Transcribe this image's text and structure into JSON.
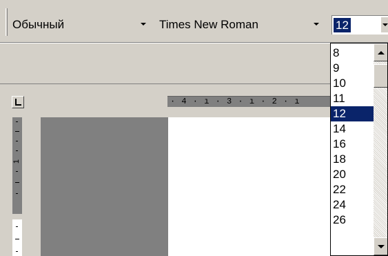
{
  "toolbar": {
    "style_combo": {
      "value": "Обычный"
    },
    "font_combo": {
      "value": "Times New Roman"
    },
    "size_combo": {
      "value": "12"
    }
  },
  "ruler": {
    "horizontal_text": "· 4 · ı · 3 · ı · 2 · ı",
    "vertical_number": "1"
  },
  "size_dropdown": {
    "items": [
      "8",
      "9",
      "10",
      "11",
      "12",
      "14",
      "16",
      "18",
      "20",
      "22",
      "24",
      "26"
    ],
    "selected": "12"
  },
  "colors": {
    "selection": "#0a246a",
    "face": "#d4d0c8",
    "workspace": "#808080",
    "page": "#ffffff"
  },
  "icons": {
    "combo_arrow": "chevron-down-icon",
    "scroll_up": "scroll-up-icon",
    "scroll_down": "scroll-down-icon",
    "tab_selector": "left-tab-icon"
  }
}
